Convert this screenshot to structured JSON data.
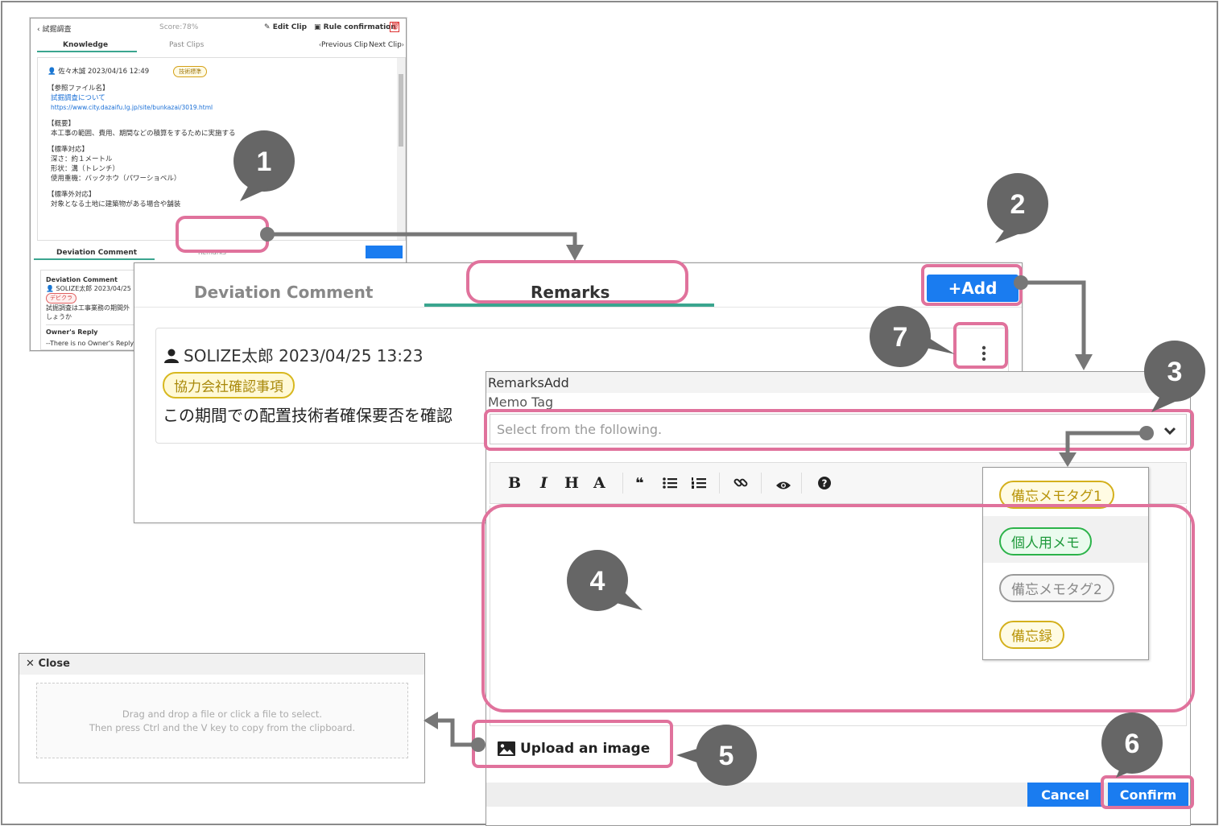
{
  "bg_panel": {
    "back_label": "試掘調査",
    "score": "Score:78%",
    "edit_clip": "Edit Clip",
    "rule_confirmation": "Rule confirmation",
    "tab_knowledge": "Knowledge",
    "tab_past_clips": "Past Clips",
    "previous_clip": "Previous Clip",
    "next_clip": "Next Clip",
    "author_line": "佐々木誠 2023/04/16 12:49",
    "badge": "技術標準",
    "ref_heading": "【参照ファイル名】",
    "ref_link_title": "試掘調査について",
    "ref_url": "https://www.city.dazaifu.lg.jp/site/bunkazai/3019.html",
    "overview_heading": "【概要】",
    "overview_text": "本工事の範囲、費用、期間などの積算をするために実施する",
    "std_heading": "【標準対応】",
    "std_line1": "深さ：約１メートル",
    "std_line2": "形状：溝（トレンチ）",
    "std_line3": "使用重機：バックホウ（パワーショベル）",
    "nonstd_heading": "【標準外対応】",
    "nonstd_line1": "対象となる土地に建築物がある場合や舗装",
    "tab_deviation": "Deviation Comment",
    "tab_remarks": "Remarks",
    "dev_comment_title": "Deviation Comment",
    "dev_author": "SOLIZE太郎 2023/04/25",
    "dev_tag": "デビクラ",
    "dev_text1": "試掘調査は工事業務の期間外",
    "dev_text2": "しょうか",
    "owner_reply_title": "Owner's Reply",
    "owner_reply_text": "--There is no Owner's Reply"
  },
  "main_panel": {
    "tab_deviation": "Deviation Comment",
    "tab_remarks": "Remarks",
    "add_button": "+Add",
    "author_line": "SOLIZE太郎 2023/04/25 13:23",
    "tag": "協力会社確認事項",
    "body": "この期間での配置技術者確保要否を確認"
  },
  "dialog": {
    "title": "RemarksAdd",
    "memo_tag_label": "Memo Tag",
    "select_placeholder": "Select from the following.",
    "toolbar": [
      "B",
      "I",
      "H",
      "A"
    ],
    "upload_label": "Upload an image",
    "cancel": "Cancel",
    "confirm": "Confirm"
  },
  "dropdown": {
    "options": [
      {
        "label": "備忘メモタグ1",
        "color": "#d4b01c"
      },
      {
        "label": "個人用メモ",
        "color": "#2cb34a"
      },
      {
        "label": "備忘メモタグ2",
        "color": "#9a9a9a"
      },
      {
        "label": "備忘録",
        "color": "#d4b01c"
      }
    ]
  },
  "close_panel": {
    "close_label": "Close",
    "dropzone_line1": "Drag and drop a file or click a file to select.",
    "dropzone_line2": "Then press Ctrl and the V key to copy from the clipboard."
  },
  "callouts": [
    "1",
    "2",
    "3",
    "4",
    "5",
    "6",
    "7"
  ],
  "colors": {
    "highlight": "#e0729c",
    "accent_blue": "#1a7cf0",
    "tab_underline": "#3aa58f",
    "callout_fill": "#666666"
  }
}
